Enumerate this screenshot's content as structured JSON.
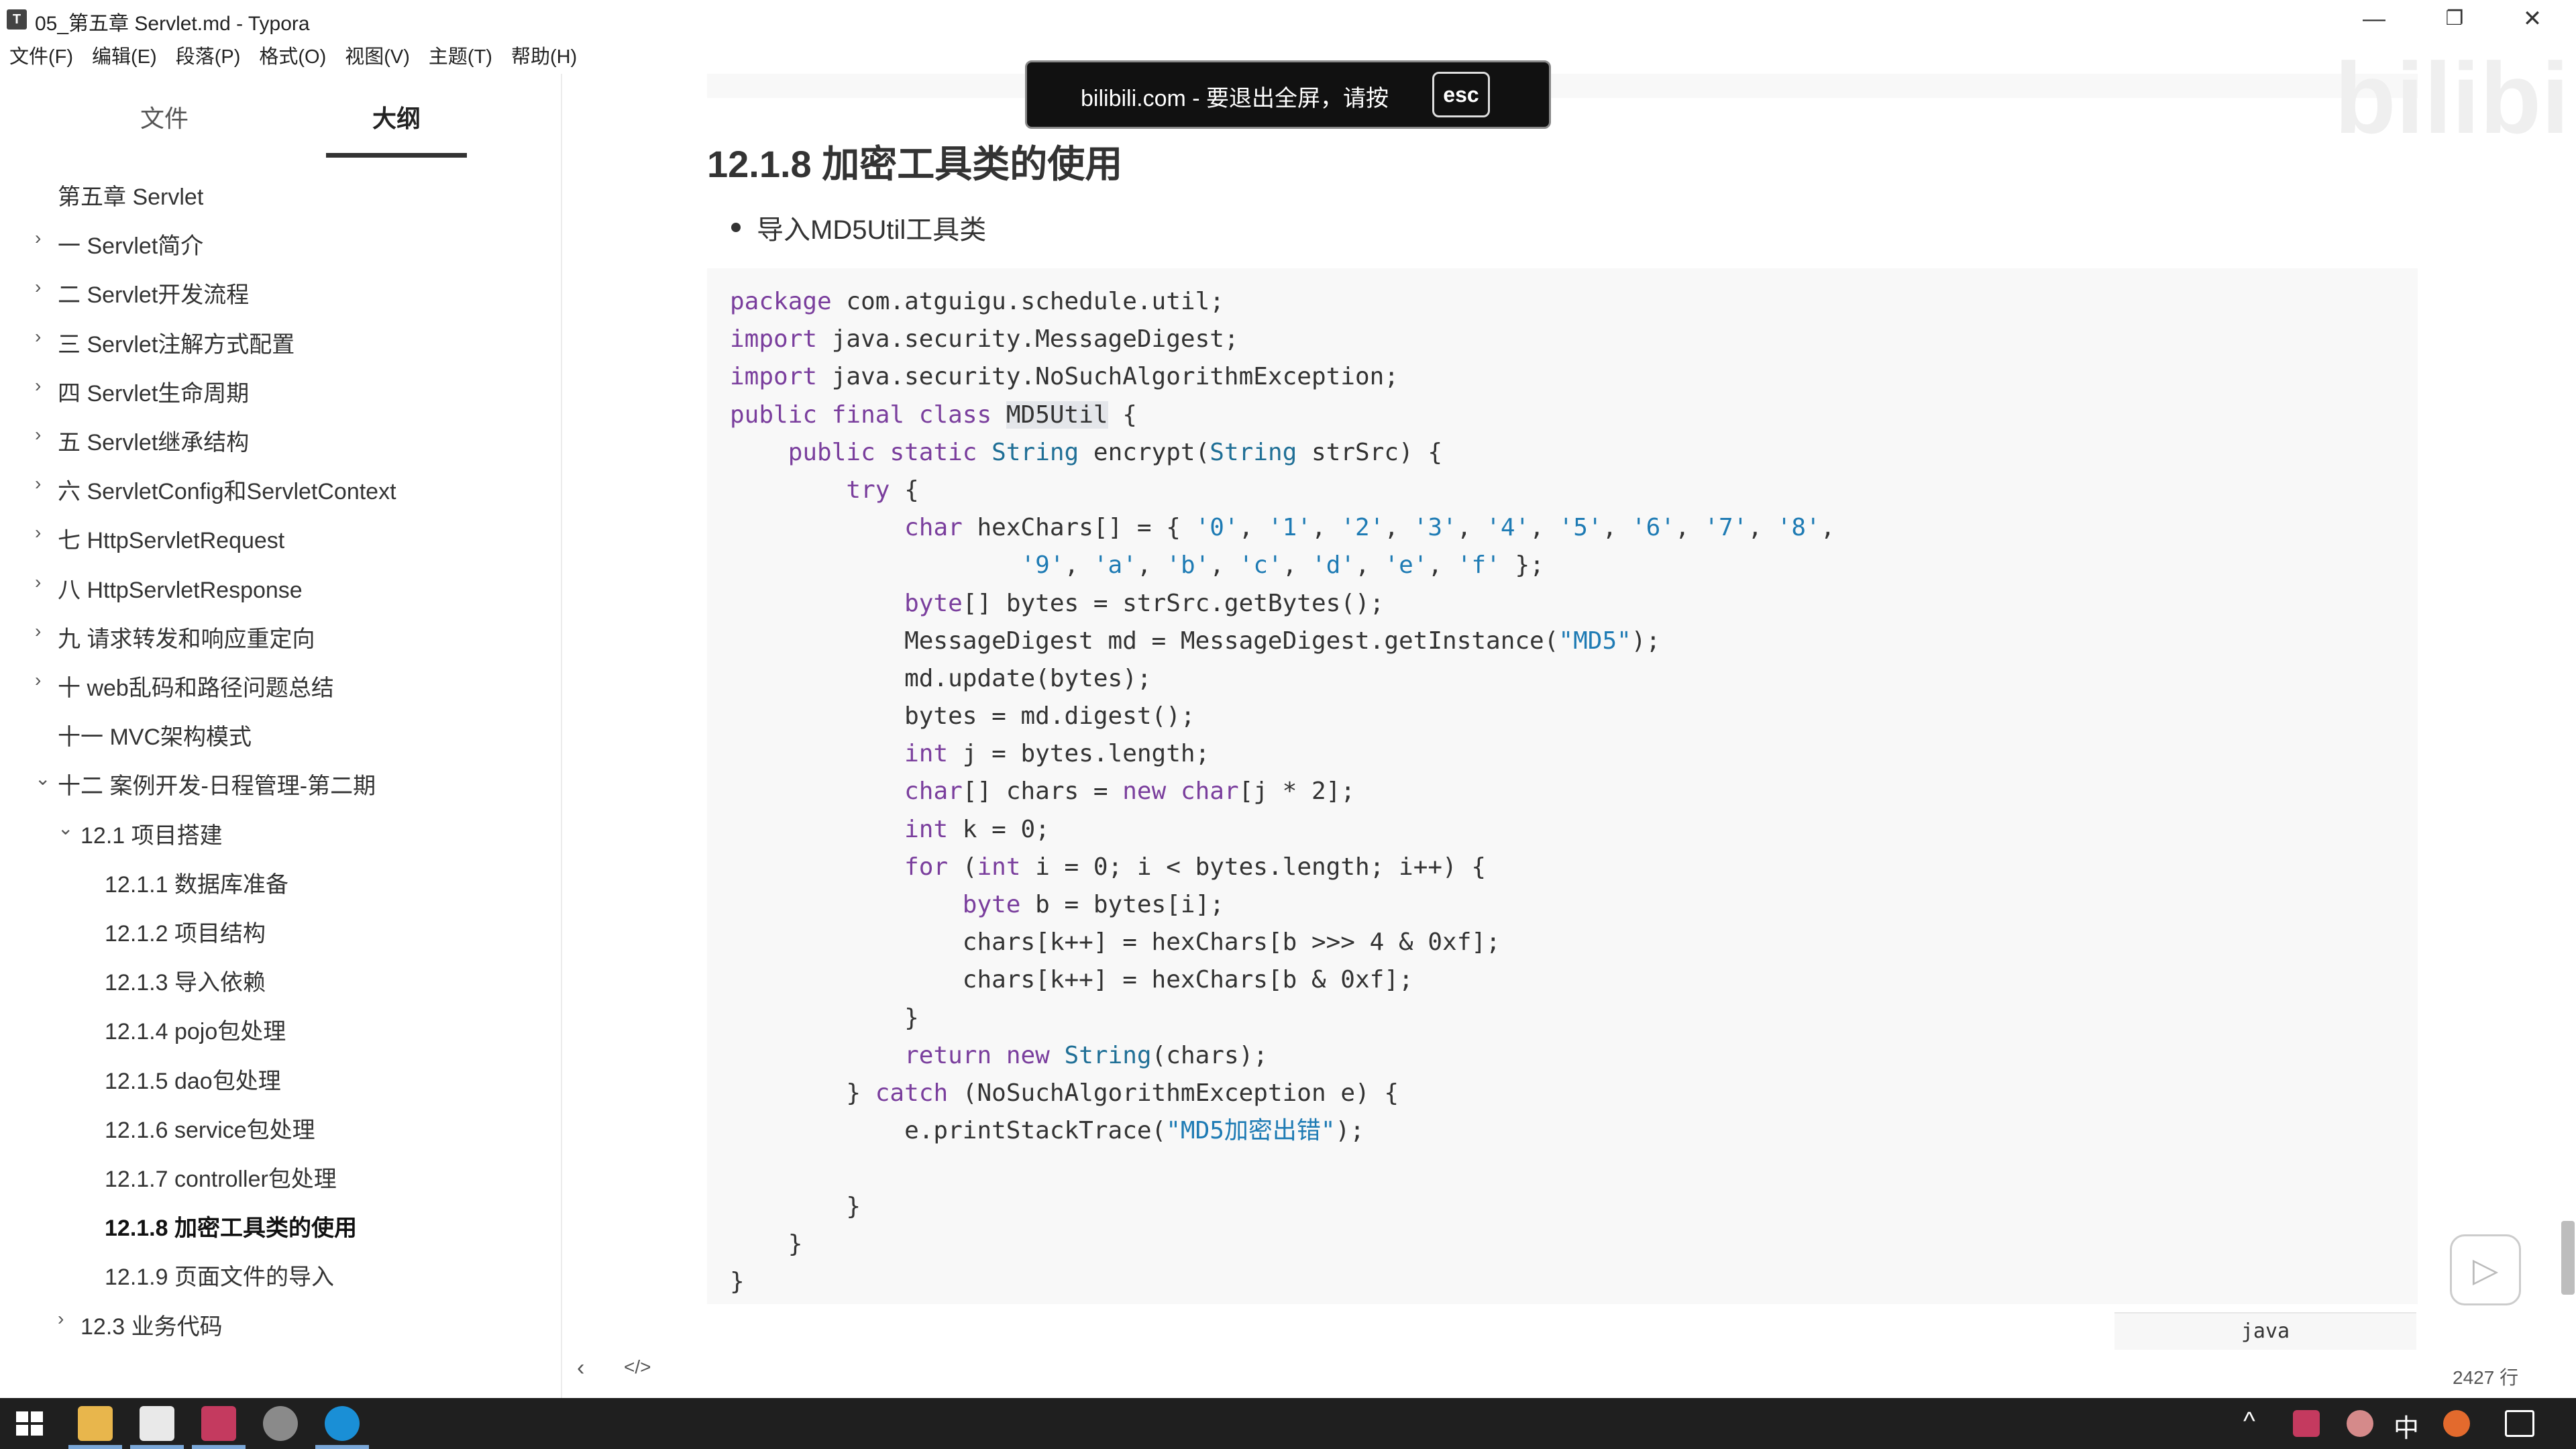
{
  "window": {
    "title": "05_第五章 Servlet.md - Typora",
    "app_icon_letter": "T",
    "controls": {
      "minimize": "—",
      "maximize": "❐",
      "close": "✕"
    }
  },
  "menu": [
    "文件(F)",
    "编辑(E)",
    "段落(P)",
    "格式(O)",
    "视图(V)",
    "主题(T)",
    "帮助(H)"
  ],
  "sidebar": {
    "tabs": [
      {
        "label": "文件",
        "active": false
      },
      {
        "label": "大纲",
        "active": true
      }
    ],
    "outline": [
      {
        "label": "第五章 Servlet",
        "level": 0,
        "chevron": ""
      },
      {
        "label": "一 Servlet简介",
        "level": 1,
        "chevron": "›"
      },
      {
        "label": "二 Servlet开发流程",
        "level": 1,
        "chevron": "›"
      },
      {
        "label": "三 Servlet注解方式配置",
        "level": 1,
        "chevron": "›"
      },
      {
        "label": "四 Servlet生命周期",
        "level": 1,
        "chevron": "›"
      },
      {
        "label": "五 Servlet继承结构",
        "level": 1,
        "chevron": "›"
      },
      {
        "label": "六 ServletConfig和ServletContext",
        "level": 1,
        "chevron": "›"
      },
      {
        "label": "七 HttpServletRequest",
        "level": 1,
        "chevron": "›"
      },
      {
        "label": "八 HttpServletResponse",
        "level": 1,
        "chevron": "›"
      },
      {
        "label": "九 请求转发和响应重定向",
        "level": 1,
        "chevron": "›"
      },
      {
        "label": "十 web乱码和路径问题总结",
        "level": 1,
        "chevron": "›"
      },
      {
        "label": "十一 MVC架构模式",
        "level": 1,
        "chevron": ""
      },
      {
        "label": "十二 案例开发-日程管理-第二期",
        "level": 1,
        "chevron": "⌄"
      },
      {
        "label": "12.1 项目搭建",
        "level": 2,
        "chevron": "⌄"
      },
      {
        "label": "12.1.1 数据库准备",
        "level": 3,
        "chevron": ""
      },
      {
        "label": "12.1.2 项目结构",
        "level": 3,
        "chevron": ""
      },
      {
        "label": "12.1.3 导入依赖",
        "level": 3,
        "chevron": ""
      },
      {
        "label": "12.1.4 pojo包处理",
        "level": 3,
        "chevron": ""
      },
      {
        "label": "12.1.5 dao包处理",
        "level": 3,
        "chevron": ""
      },
      {
        "label": "12.1.6 service包处理",
        "level": 3,
        "chevron": ""
      },
      {
        "label": "12.1.7 controller包处理",
        "level": 3,
        "chevron": ""
      },
      {
        "label": "12.1.8 加密工具类的使用",
        "level": 3,
        "chevron": "",
        "active": true
      },
      {
        "label": "12.1.9 页面文件的导入",
        "level": 3,
        "chevron": ""
      },
      {
        "label": "12.3 业务代码",
        "level": 2,
        "chevron": "›"
      }
    ],
    "footer_icons": {
      "back": "‹",
      "source": "</>"
    }
  },
  "toast": {
    "text": "bilibili.com - 要退出全屏，请按",
    "key": "esc"
  },
  "watermark": "bilibili",
  "content": {
    "heading": "12.1.8 加密工具类的使用",
    "bullet": "导入MD5Util工具类",
    "code_language": "java",
    "line_count": "2427 行",
    "code_lines": [
      "package com.atguigu.schedule.util;",
      "import java.security.MessageDigest;",
      "import java.security.NoSuchAlgorithmException;",
      "public final class MD5Util {",
      "    public static String encrypt(String strSrc) {",
      "        try {",
      "            char hexChars[] = { '0', '1', '2', '3', '4', '5', '6', '7', '8',",
      "                    '9', 'a', 'b', 'c', 'd', 'e', 'f' };",
      "            byte[] bytes = strSrc.getBytes();",
      "            MessageDigest md = MessageDigest.getInstance(\"MD5\");",
      "            md.update(bytes);",
      "            bytes = md.digest();",
      "            int j = bytes.length;",
      "            char[] chars = new char[j * 2];",
      "            int k = 0;",
      "            for (int i = 0; i < bytes.length; i++) {",
      "                byte b = bytes[i];",
      "                chars[k++] = hexChars[b >>> 4 & 0xf];",
      "                chars[k++] = hexChars[b & 0xf];",
      "            }",
      "            return new String(chars);",
      "        } catch (NoSuchAlgorithmException e) {",
      "            e.printStackTrace(\"MD5加密出错\");",
      "",
      "        }",
      "    }",
      "}"
    ]
  },
  "taskbar": {
    "tray": {
      "caret": "^",
      "ime": "中"
    }
  },
  "colors": {
    "keyword": "#7a3e9d",
    "string": "#1e7bb4",
    "type": "#1f6f96",
    "taskbar": "#1f1f1f"
  }
}
